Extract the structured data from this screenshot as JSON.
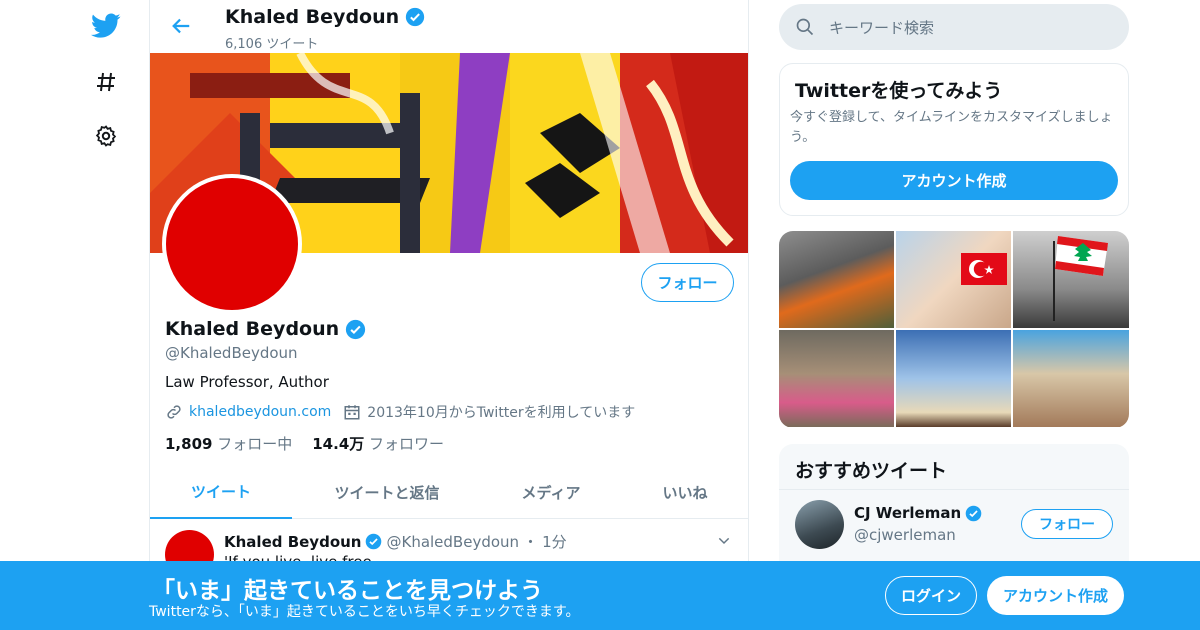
{
  "colors": {
    "accent": "#1da1f2",
    "verified": "#1da1f2",
    "bottom_bar": "#1da1f2",
    "avatar": "#e00000"
  },
  "nav": {
    "icons": [
      "twitter-bird-icon",
      "hashtag-icon",
      "gear-icon"
    ]
  },
  "header": {
    "back_icon": "arrow-left-icon",
    "name": "Khaled Beydoun",
    "tweet_count": "6,106 ツイート"
  },
  "profile": {
    "follow_label": "フォロー",
    "name": "Khaled Beydoun",
    "handle": "@KhaledBeydoun",
    "bio": "Law Professor, Author",
    "link": "khaledbeydoun.com",
    "joined": "2013年10月からTwitterを利用しています",
    "following_count": "1,809",
    "following_label": "フォロー中",
    "followers_count": "14.4万",
    "followers_label": "フォロワー"
  },
  "tabs": [
    {
      "label": "ツイート",
      "active": true
    },
    {
      "label": "ツイートと返信",
      "active": false
    },
    {
      "label": "メディア",
      "active": false
    },
    {
      "label": "いいね",
      "active": false
    }
  ],
  "tweet": {
    "name": "Khaled Beydoun",
    "handle": "@KhaledBeydoun",
    "dot": "・",
    "time": "1分",
    "text": "'If you live, live free"
  },
  "search": {
    "placeholder": "キーワード検索"
  },
  "signup_card": {
    "title": "Twitterを使ってみよう",
    "subtitle": "今すぐ登録して、タイムラインをカスタマイズしましょう。",
    "button": "アカウント作成"
  },
  "recommend": {
    "title": "おすすめツイート",
    "user_name": "CJ Werleman",
    "user_handle": "@cjwerleman",
    "follow_label": "フォロー"
  },
  "bottom_bar": {
    "title": "「いま」起きていることを見つけよう",
    "subtitle": "Twitterなら、「いま」起きていることをいち早くチェックできます。",
    "login": "ログイン",
    "signup": "アカウント作成"
  }
}
